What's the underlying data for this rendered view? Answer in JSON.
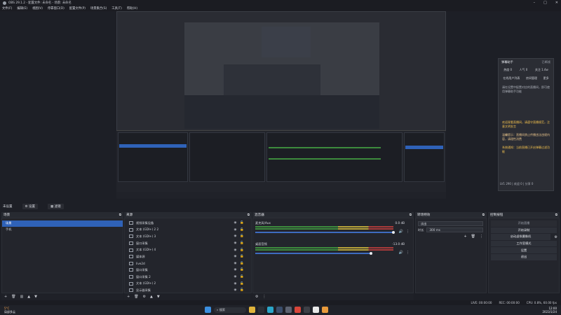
{
  "window": {
    "title": "OBS 29.1.2 - 配置文件: 未命名 - 场景: 未命名"
  },
  "menu": [
    "文件(F)",
    "编辑(E)",
    "视图(V)",
    "停靠窗口(D)",
    "配置文件(P)",
    "场景集合(S)",
    "工具(T)",
    "帮助(H)"
  ],
  "chat": {
    "title": "弹幕助手",
    "header_right": "已断线",
    "tabs": [
      "热度 0",
      "人气 0",
      "关注 1.4w"
    ],
    "tabs2": [
      "在线用户列表",
      "房间管理",
      "更多"
    ],
    "notice": "请在设置中配置对应的直播间，即可使用弹幕助手功能",
    "messages": [
      "欢迎观看直播间，请遵守直播规范，注意文明发言",
      "温馨提示：直播间禁止传播违法违规内容，请理性消费",
      "系统通知：当前直播已开启弹幕过滤功能"
    ],
    "footer": "LV1 290 | 欢迎 0 | 分享 0"
  },
  "scene_bar": {
    "label": "未设置",
    "btn1": "设置",
    "btn2": "滤镜"
  },
  "scenes": {
    "title": "场景",
    "items": [
      "场景",
      "手机"
    ]
  },
  "sources": {
    "title": "来源",
    "items": [
      "视频采集设备",
      "文本 (GDI+) 2 2",
      "文本 (GDI+) 3",
      "窗口采集",
      "文本 (GDI+) 4",
      "媒体源",
      "live2d",
      "窗口采集",
      "窗口采集 2",
      "文本 (GDI+) 2",
      "显示器采集"
    ]
  },
  "mixer": {
    "title": "混音器",
    "channels": [
      {
        "name": "麦克风/Aux",
        "db": "0.0 dB"
      },
      {
        "name": "桌面音频",
        "db": "-13.0 dB"
      }
    ]
  },
  "transitions": {
    "title": "转场特效",
    "type": "淡出",
    "duration_label": "时长",
    "duration": "300 ms"
  },
  "controls": {
    "title": "控制按钮",
    "buttons": [
      "开始直播",
      "开始录制",
      "启动虚拟摄像机",
      "工作室模式",
      "设置",
      "退出"
    ]
  },
  "status": {
    "live": "LIVE: 00:00:00",
    "rec": "REC: 00:00:00",
    "cpu": "CPU: 0.8%, 60.00 fps"
  },
  "taskbar": {
    "weather_temp": "5°C",
    "weather_desc": "局部多云",
    "search": "搜索",
    "time": "12:00",
    "date": "2023/1/24"
  },
  "colors": {
    "accent": "#2f62b8",
    "bg": "#1d1f26",
    "panel": "#23252c"
  }
}
